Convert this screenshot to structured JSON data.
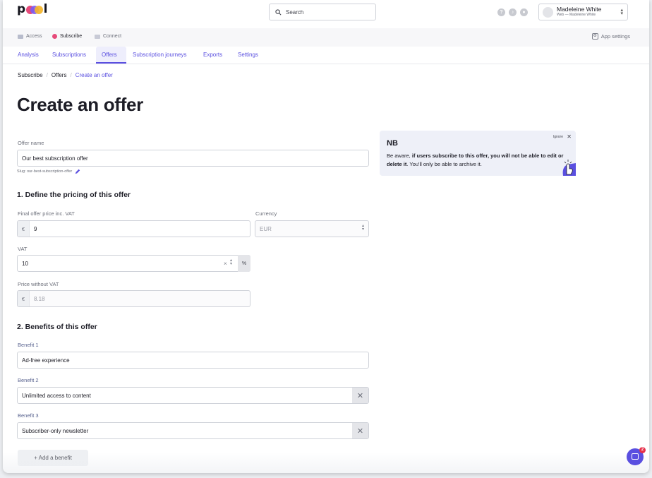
{
  "app": {
    "logo_text_left": "p",
    "logo_text_right": "l"
  },
  "search": {
    "placeholder": "Search"
  },
  "user": {
    "name": "Madeleine White",
    "subtitle": "Web — Madeleine White"
  },
  "products": [
    {
      "label": "Access",
      "color": "#b8bccc"
    },
    {
      "label": "Subscribe",
      "color": "#e64a7a"
    },
    {
      "label": "Connect",
      "color": "#c8cad6"
    }
  ],
  "app_settings": {
    "label": "App settings"
  },
  "tabs": [
    {
      "label": "Analysis"
    },
    {
      "label": "Subscriptions"
    },
    {
      "label": "Offers"
    },
    {
      "label": "Subscription journeys"
    },
    {
      "label": "Exports"
    },
    {
      "label": "Settings"
    }
  ],
  "breadcrumb": [
    "Subscribe",
    "Offers",
    "Create an offer"
  ],
  "page_title": "Create an offer",
  "form": {
    "offer_name": {
      "label": "Offer name",
      "value": "Our best subscription offer"
    },
    "slug": "Slug: our-best-subscription-offer",
    "section1": "1. Define the pricing of this offer",
    "final_price": {
      "label": "Final offer price inc. VAT",
      "currency_symbol": "€",
      "value": "9"
    },
    "currency": {
      "label": "Currency",
      "value": "EUR"
    },
    "vat": {
      "label": "VAT",
      "value": "10",
      "unit": "%"
    },
    "price_without_vat": {
      "label": "Price without VAT",
      "currency_symbol": "€",
      "value": "8.18"
    },
    "section2": "2. Benefits of this offer",
    "benefits": [
      {
        "label": "Benefit 1",
        "value": "Ad-free experience"
      },
      {
        "label": "Benefit 2",
        "value": "Unlimited access to content"
      },
      {
        "label": "Benefit 3",
        "value": "Subscriber-only newsletter"
      }
    ],
    "add_benefit": "+ Add a benefit"
  },
  "nb_card": {
    "title": "NB",
    "ignore": "Ignore",
    "msg_pre": "Be aware, ",
    "msg_bold": "if users subscribe to this offer, you will not be able to edit or delete it",
    "msg_post": ". You'll only be able to archive it."
  },
  "chat": {
    "badge": "2"
  },
  "colors": {
    "accent": "#5a4fe0",
    "brand_pink": "#e64a7a"
  }
}
